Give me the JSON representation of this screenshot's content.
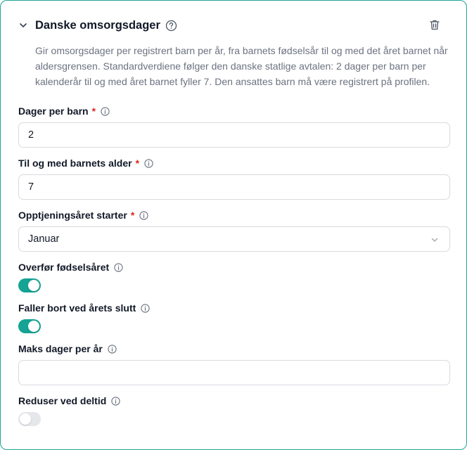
{
  "section": {
    "title": "Danske omsorgsdager",
    "description": "Gir omsorgsdager per registrert barn per år, fra barnets fødselsår til og med det året barnet når aldersgrensen. Standardverdiene følger den danske statlige avtalen: 2 dager per barn per kalenderår til og med året barnet fyller 7. Den ansattes barn må være registrert på profilen."
  },
  "fields": {
    "days_per_child": {
      "label": "Dager per barn",
      "required_mark": "*",
      "value": "2"
    },
    "child_age_limit": {
      "label": "Til og med barnets alder",
      "required_mark": "*",
      "value": "7"
    },
    "earning_year_start": {
      "label": "Opptjeningsåret starter",
      "required_mark": "*",
      "value": "Januar"
    },
    "transfer_birth_year": {
      "label": "Overfør fødselsåret",
      "enabled": true
    },
    "expires_year_end": {
      "label": "Faller bort ved årets slutt",
      "enabled": true
    },
    "max_days_per_year": {
      "label": "Maks dager per år",
      "value": ""
    },
    "reduce_part_time": {
      "label": "Reduser ved deltid",
      "enabled": false
    }
  },
  "colors": {
    "accent": "#14a394",
    "card_border": "#20a596",
    "required": "#dc2626"
  },
  "icons": {
    "collapse": "chevron-down-icon",
    "help": "help-circle-icon",
    "delete": "trash-icon",
    "info": "info-icon",
    "select": "chevron-down-icon"
  }
}
